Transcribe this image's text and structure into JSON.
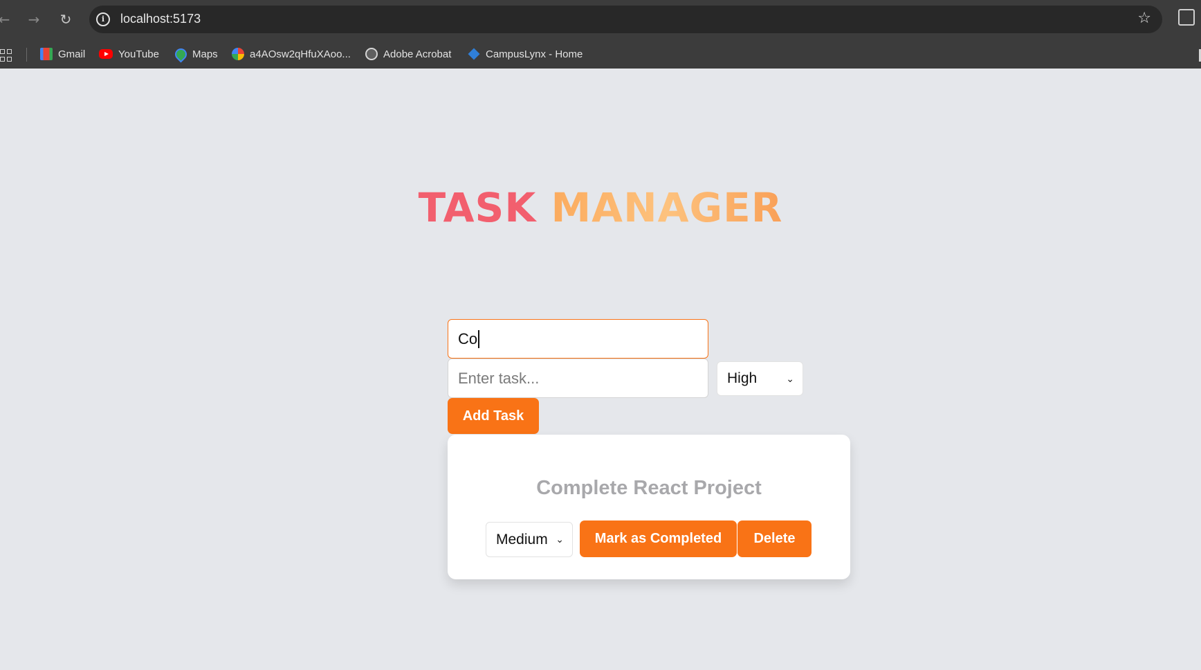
{
  "browser": {
    "url": "localhost:5173",
    "bookmarks": [
      {
        "label": "Gmail",
        "icon": "gmail-icon"
      },
      {
        "label": "YouTube",
        "icon": "youtube-icon"
      },
      {
        "label": "Maps",
        "icon": "maps-icon"
      },
      {
        "label": "a4AOsw2qHfuXAoo...",
        "icon": "photos-icon"
      },
      {
        "label": "Adobe Acrobat",
        "icon": "globe-icon"
      },
      {
        "label": "CampusLynx - Home",
        "icon": "campuslynx-icon"
      }
    ]
  },
  "app": {
    "title_part1": "TASK",
    "title_part2": "MANAGER",
    "form": {
      "top_input_value": "Co",
      "task_input_placeholder": "Enter task...",
      "priority_selected": "High",
      "add_button": "Add Task"
    },
    "tasks": [
      {
        "title": "Complete React Project",
        "priority": "Medium",
        "complete_button": "Mark as Completed",
        "delete_button": "Delete"
      }
    ]
  },
  "colors": {
    "accent": "#f97316",
    "title_red": "#f25f6e",
    "title_orange": "#fdb66c",
    "page_bg": "#e5e7eb"
  }
}
